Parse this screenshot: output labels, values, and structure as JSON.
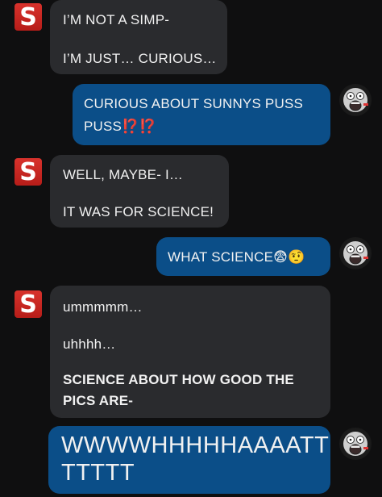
{
  "messages": [
    {
      "sender": "S",
      "lines": [
        "I’M NOT A SIMP-",
        "I’M JUST… CURIOUS…"
      ]
    },
    {
      "sender": "me",
      "lines": [
        "CURIOUS ABOUT SUNNYS PUSS",
        "PUSS⁉️⁉️"
      ]
    },
    {
      "sender": "S",
      "lines": [
        "WELL, MAYBE- I…",
        "IT WAS FOR SCIENCE!"
      ]
    },
    {
      "sender": "me",
      "lines": [
        "WHAT SCIENCE😨🤨"
      ]
    },
    {
      "sender": "S",
      "lines": [
        "ummmmm…",
        "uhhhh…",
        "SCIENCE ABOUT HOW GOOD THE",
        "PICS ARE-"
      ]
    },
    {
      "sender": "me",
      "lines": [
        "WWWWHHHHHAAAATT",
        "TTTTT"
      ]
    }
  ],
  "avatars": {
    "other": {
      "letter": "S",
      "color": "#c9241f"
    },
    "me": {
      "icon": "screaming-robot-face-icon"
    }
  },
  "colors": {
    "incoming": "#2a2b2e",
    "outgoing": "#0b4e88",
    "background": "#0f0f10"
  }
}
